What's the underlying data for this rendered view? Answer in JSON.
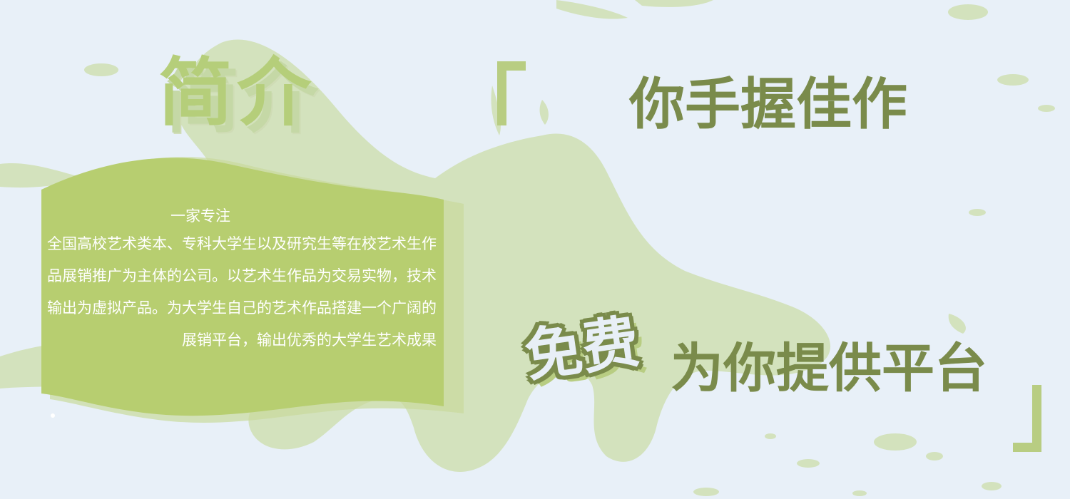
{
  "intro": {
    "title": "简介",
    "heading": "一家专注",
    "body": "全国高校艺术类本、专科大学生以及研究生等在校艺术生作品展销推广为主体的公司。以艺术生作品为交易实物，技术输出为虚拟产品。为大学生自己的艺术作品搭建一个广阔的展销平台，输出优秀的大学生艺术成果"
  },
  "slogan": {
    "line1": "你手握佳作",
    "free_badge": "免费",
    "line2": "为你提供平台"
  },
  "colors": {
    "background": "#e8f0f8",
    "splash": "#cfdfb8",
    "panel": "#b7ce70",
    "accent_dark": "#7a8b4b",
    "bracket": "#b8cd82"
  }
}
